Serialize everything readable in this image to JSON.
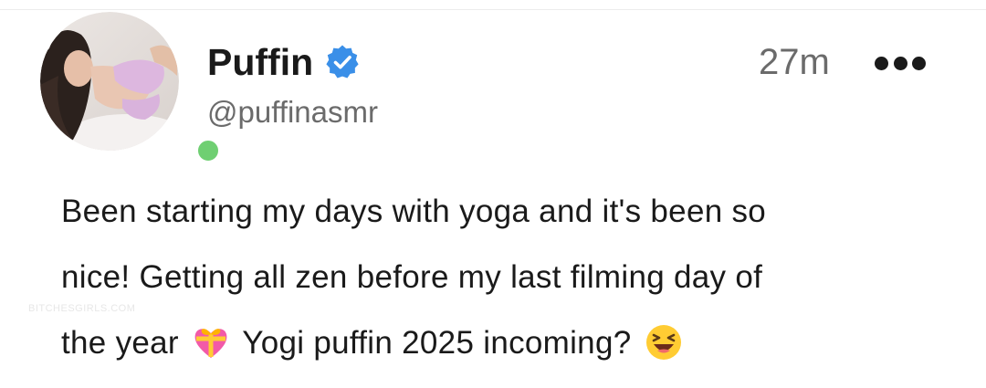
{
  "post": {
    "display_name": "Puffin",
    "handle": "@puffinasmr",
    "timestamp": "27m",
    "online": true,
    "verified": true,
    "lines": [
      "Been starting my days with yoga and it's been so",
      "nice! Getting all zen before my last filming day of"
    ],
    "line3_part1": "the year",
    "line3_part2": "Yogi puffin 2025 incoming?",
    "emojis": [
      "gift-heart-icon",
      "laughing-face-icon"
    ]
  },
  "watermark": "BITCHESGIRLS.COM",
  "colors": {
    "verified_badge": "#3a8fe8",
    "online_dot": "#6fcf72",
    "secondary_text": "#6b6b6b"
  },
  "icons": {
    "verified": "verified-badge-icon",
    "more": "more-options-icon"
  }
}
